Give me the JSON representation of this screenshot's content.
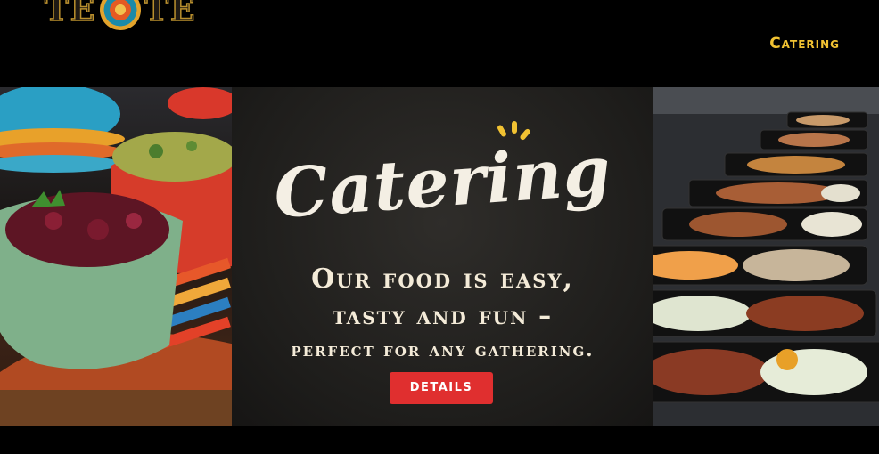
{
  "brand": {
    "logo_letters_left": "TE",
    "logo_letters_right": "TE",
    "logo_icon": "aztec-sun-medallion-icon"
  },
  "nav": {
    "catering_label": "Catering"
  },
  "hero": {
    "script_title": "Catering",
    "tagline_line1": "Our food is easy,",
    "tagline_line2": "tasty and fun –",
    "tagline_line3": "perfect for any gathering.",
    "details_label": "DETAILS",
    "left_image": "bowls-of-beets-and-guacamole-photo",
    "right_image": "catering-meal-containers-photo"
  },
  "colors": {
    "accent_yellow": "#f1c232",
    "button_red": "#e02f2f",
    "panel_bg": "#1e1d1b",
    "cream_text": "#f4ebd8"
  }
}
